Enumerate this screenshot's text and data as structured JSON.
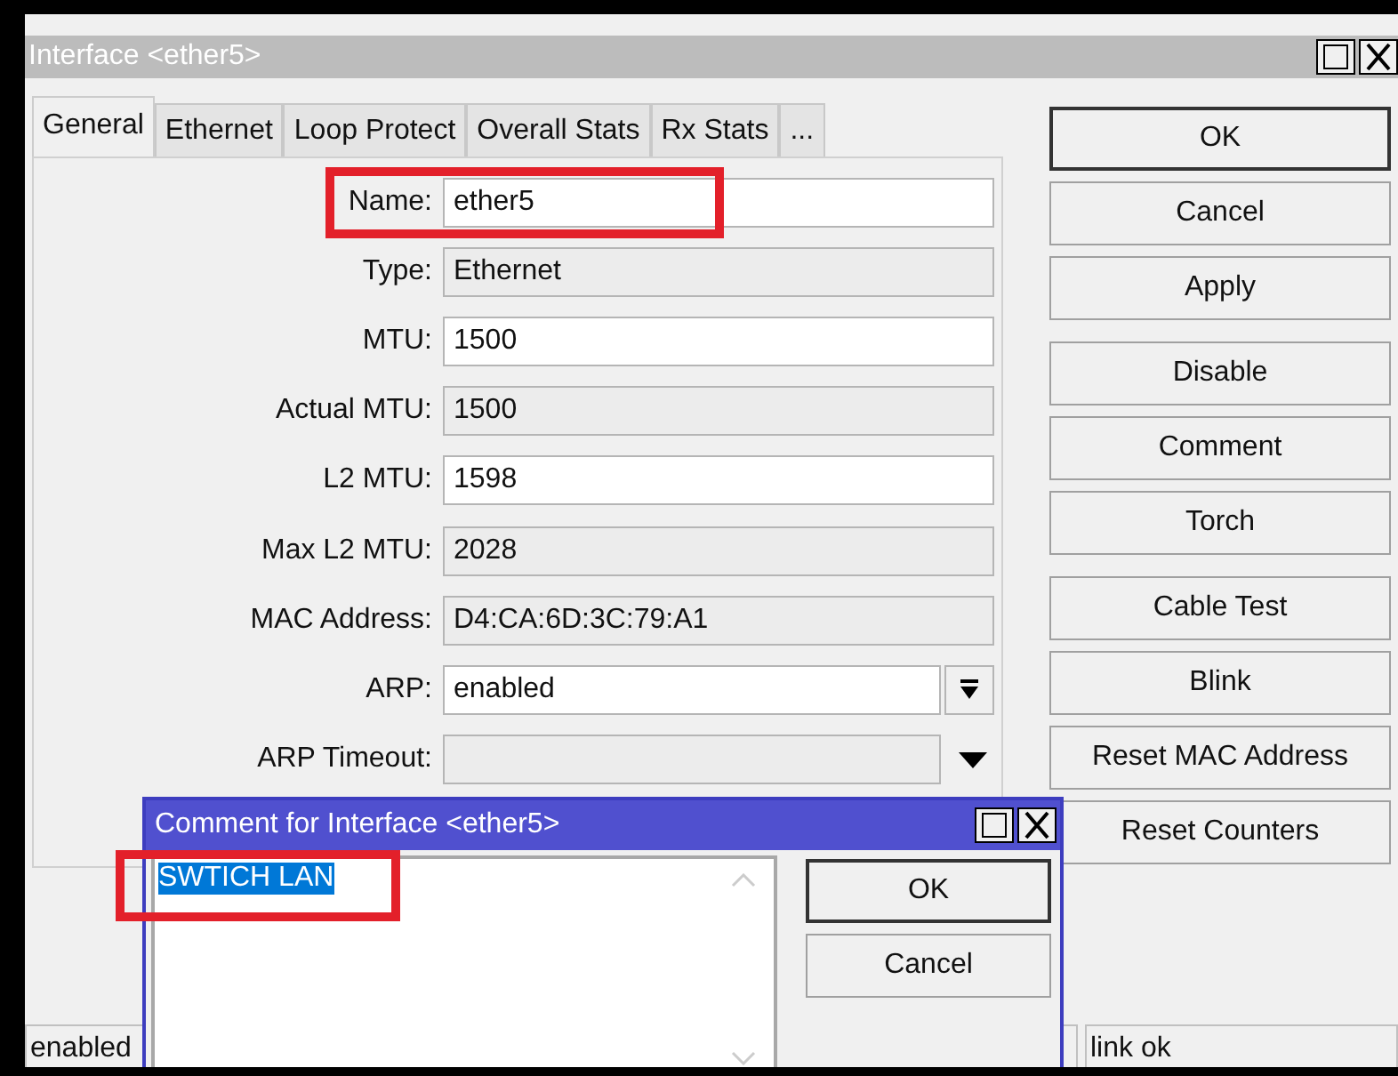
{
  "window": {
    "title": "Interface <ether5>"
  },
  "tabs": [
    {
      "label": "General",
      "selected": true
    },
    {
      "label": "Ethernet",
      "selected": false
    },
    {
      "label": "Loop Protect",
      "selected": false
    },
    {
      "label": "Overall Stats",
      "selected": false
    },
    {
      "label": "Rx Stats",
      "selected": false
    },
    {
      "label": "...",
      "selected": false
    }
  ],
  "fields": [
    {
      "label": "Name:",
      "value": "ether5",
      "kind": "input",
      "highlighted": true
    },
    {
      "label": "Type:",
      "value": "Ethernet",
      "kind": "readonly",
      "highlighted": false
    },
    {
      "label": "MTU:",
      "value": "1500",
      "kind": "input",
      "highlighted": false
    },
    {
      "label": "Actual MTU:",
      "value": "1500",
      "kind": "readonly",
      "highlighted": false
    },
    {
      "label": "L2 MTU:",
      "value": "1598",
      "kind": "input",
      "highlighted": false
    },
    {
      "label": "Max L2 MTU:",
      "value": "2028",
      "kind": "readonly",
      "highlighted": false
    },
    {
      "label": "MAC Address:",
      "value": "D4:CA:6D:3C:79:A1",
      "kind": "readonly",
      "highlighted": false
    },
    {
      "label": "ARP:",
      "value": "enabled",
      "kind": "dropdown",
      "highlighted": false
    },
    {
      "label": "ARP Timeout:",
      "kind": "optional",
      "highlighted": false
    }
  ],
  "buttons": [
    "OK",
    "Cancel",
    "Apply",
    "Disable",
    "Comment",
    "Torch",
    "Cable Test",
    "Blink",
    "Reset MAC Address",
    "Reset Counters"
  ],
  "status_bar": [
    "enabled",
    "link ok"
  ],
  "dialog": {
    "title": "Comment for Interface <ether5>",
    "comment": "SWTICH LAN",
    "highlighted": true,
    "buttons": [
      "OK",
      "Cancel"
    ]
  }
}
